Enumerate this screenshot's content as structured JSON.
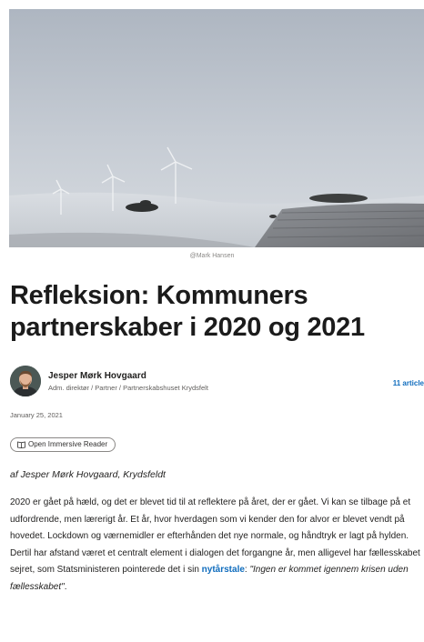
{
  "hero": {
    "image_alt": "Snowy field with wind turbines under an overcast sky",
    "credit": "@Mark Hansen"
  },
  "article": {
    "title": "Refleksion: Kommuners partnerskaber i 2020 og 2021",
    "author": {
      "name": "Jesper Mørk Hovgaard",
      "role": "Adm. direktør / Partner / Partnerskabshuset Krydsfelt"
    },
    "articles_count": "11 article",
    "date": "January 25, 2021",
    "immersive_reader_label": "Open Immersive Reader",
    "byline": "af Jesper Mørk Hovgaard, Krydsfeldt",
    "body": {
      "text": "2020 er gået på hæld, og det er blevet tid til at reflektere på året, der er gået. Vi kan se tilbage på et udfordrende, men lærerigt år. Et år, hvor hverdagen som vi kender den for alvor er blevet vendt på hovedet. Lockdown og værnemidler er efterhånden det nye normale, og håndtryk er lagt på hylden. Dertil har afstand været et centralt element i dialogen det forgangne år, men alligevel har fællesskabet sejret, som Statsministeren pointerede det i sin ",
      "link_text": "nytårstale",
      "after_link": ": ",
      "quote": "\"Ingen er kommet igennem krisen uden fællesskabet\"",
      "end": "."
    }
  },
  "colors": {
    "link": "#0f6cbd",
    "text": "#201f1e",
    "muted": "#605e5c"
  }
}
